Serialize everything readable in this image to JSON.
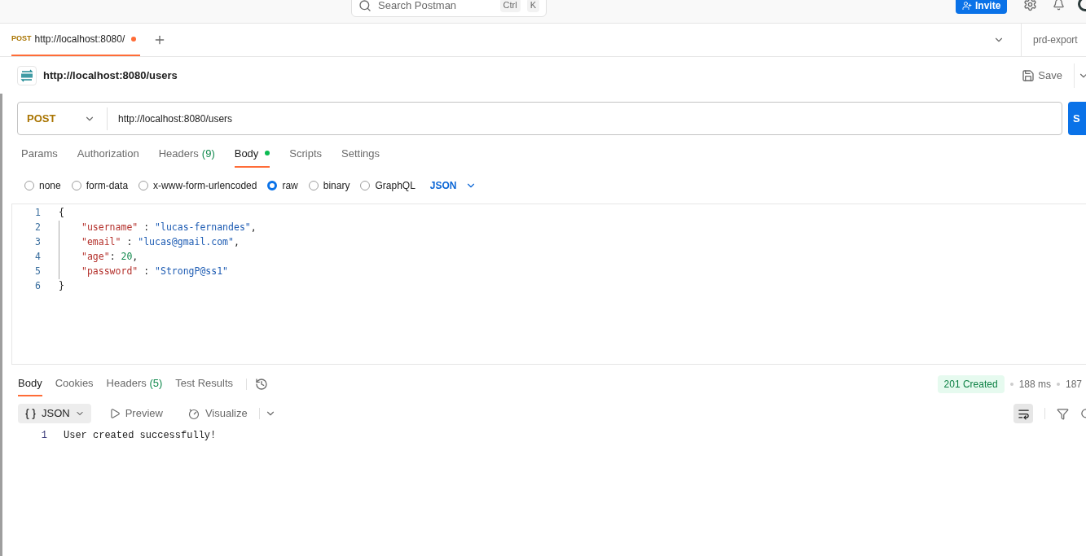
{
  "top_bar": {
    "search": {
      "placeholder": "Search Postman",
      "shortcut": [
        "Ctrl",
        "K"
      ]
    },
    "invite_button": "Invite"
  },
  "request_tabs": [
    {
      "method": "POST",
      "title": "http://localhost:8080/",
      "selected": true,
      "unsaved": true
    }
  ],
  "environment": {
    "name": "prd-export"
  },
  "request": {
    "title": "http://localhost:8080/users",
    "save_button": "Save",
    "method": "POST",
    "url": "http://localhost:8080/users",
    "send_button": "S"
  },
  "request_tabs_bar": [
    {
      "label": "Params",
      "selected": false
    },
    {
      "label": "Authorization",
      "selected": false
    },
    {
      "label": "Headers",
      "count": "(9)",
      "selected": false
    },
    {
      "label": "Body",
      "selected": true,
      "dot": true
    },
    {
      "label": "Scripts",
      "selected": false
    },
    {
      "label": "Settings",
      "selected": false
    }
  ],
  "body_types": [
    {
      "label": "none",
      "selected": false
    },
    {
      "label": "form-data",
      "selected": false
    },
    {
      "label": "x-www-form-urlencoded",
      "selected": false
    },
    {
      "label": "raw",
      "selected": true
    },
    {
      "label": "binary",
      "selected": false
    },
    {
      "label": "GraphQL",
      "selected": false
    }
  ],
  "body_format": "JSON",
  "editor_lines": [
    {
      "number": "1",
      "tokens": [
        {
          "kind": "punct",
          "text": "{"
        }
      ]
    },
    {
      "number": "2",
      "tokens": [
        {
          "kind": "key",
          "text": "\"username\""
        },
        {
          "kind": "punct",
          "text": " : "
        },
        {
          "kind": "string",
          "text": "\"lucas-fernandes\""
        },
        {
          "kind": "punct",
          "text": ","
        }
      ]
    },
    {
      "number": "3",
      "tokens": [
        {
          "kind": "key",
          "text": "\"email\""
        },
        {
          "kind": "punct",
          "text": " : "
        },
        {
          "kind": "string",
          "text": "\"lucas@gmail.com\""
        },
        {
          "kind": "punct",
          "text": ","
        }
      ]
    },
    {
      "number": "4",
      "tokens": [
        {
          "kind": "key",
          "text": "\"age\""
        },
        {
          "kind": "punct",
          "text": ": "
        },
        {
          "kind": "number",
          "text": "20"
        },
        {
          "kind": "punct",
          "text": ","
        }
      ]
    },
    {
      "number": "5",
      "tokens": [
        {
          "kind": "key",
          "text": "\"password\""
        },
        {
          "kind": "punct",
          "text": " : "
        },
        {
          "kind": "string",
          "text": "\"StrongP@ss1\""
        }
      ]
    },
    {
      "number": "6",
      "tokens": [
        {
          "kind": "punct",
          "text": "}"
        }
      ]
    }
  ],
  "response_tabs": [
    {
      "label": "Body",
      "selected": true
    },
    {
      "label": "Cookies",
      "selected": false
    },
    {
      "label": "Headers",
      "count": "(5)",
      "selected": false
    },
    {
      "label": "Test Results",
      "selected": false
    }
  ],
  "response_status": {
    "status": "201 Created",
    "time": "188 ms",
    "size": "187"
  },
  "response_views": [
    {
      "label": "JSON",
      "selected": true
    },
    {
      "label": "Preview",
      "selected": false
    },
    {
      "label": "Visualize",
      "selected": false
    }
  ],
  "response_lines": [
    {
      "number": "1",
      "text": "User created successfully!"
    }
  ]
}
